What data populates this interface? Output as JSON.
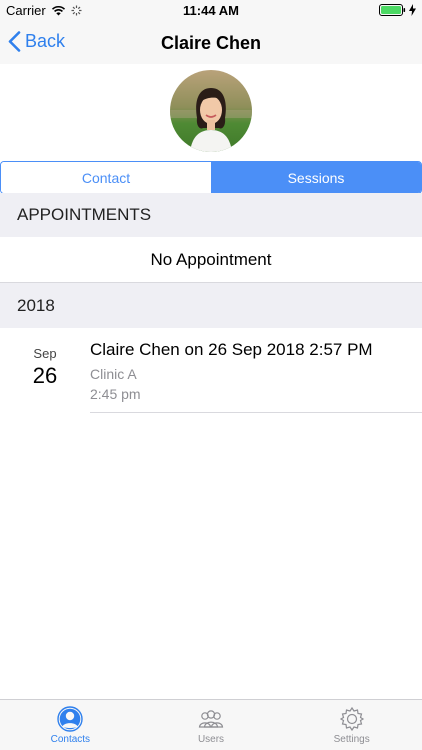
{
  "statusbar": {
    "carrier": "Carrier",
    "time": "11:44 AM"
  },
  "nav": {
    "back_label": "Back",
    "title": "Claire Chen"
  },
  "segments": [
    {
      "label": "Contact",
      "selected": false
    },
    {
      "label": "Sessions",
      "selected": true
    }
  ],
  "appointments": {
    "header": "APPOINTMENTS",
    "empty_text": "No Appointment"
  },
  "sessions": {
    "year_header": "2018",
    "items": [
      {
        "month": "Sep",
        "day": "26",
        "title": "Claire Chen on 26 Sep 2018 2:57 PM",
        "location": "Clinic A",
        "time": "2:45 pm"
      }
    ]
  },
  "tabbar": [
    {
      "label": "Contacts",
      "icon": "contacts-icon",
      "active": true
    },
    {
      "label": "Users",
      "icon": "users-icon",
      "active": false
    },
    {
      "label": "Settings",
      "icon": "gear-icon",
      "active": false
    }
  ],
  "colors": {
    "accent": "#2f80ed",
    "segment": "#4b8ff7",
    "section_bg": "#efeff4",
    "battery": "#4cd964"
  }
}
